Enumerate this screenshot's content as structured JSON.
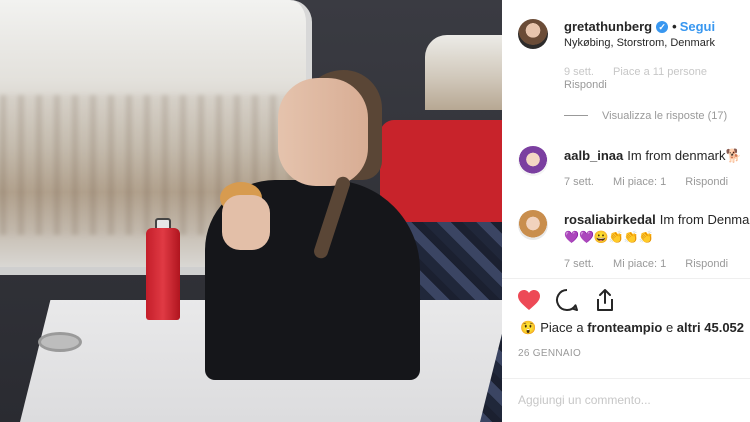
{
  "post": {
    "username": "gretathunberg",
    "follow_label": "Segui",
    "dot": "•",
    "location": "Nykøbing, Storstrom, Denmark",
    "verified_icon": "verified-badge-icon"
  },
  "caption_meta": {
    "time": "9 sett.",
    "likes": "Piace a 11 persone",
    "reply": "Rispondi"
  },
  "view_replies": "Visualizza le risposte (17)",
  "comments": [
    {
      "username": "aalb_inaa",
      "text": "Im from denmark🐕",
      "time": "7 sett.",
      "likes": "Mi piace: 1",
      "reply": "Rispondi"
    },
    {
      "username": "rosaliabirkedal",
      "text": "Im from Denmark",
      "emoji": "💜💜😀👏👏👏",
      "time": "7 sett.",
      "likes": "Mi piace: 1",
      "reply": "Rispondi"
    }
  ],
  "actions": {
    "like_icon": "heart-icon",
    "comment_icon": "comment-icon",
    "share_icon": "share-icon",
    "like_color": "#ed4956"
  },
  "likes": {
    "emoji": "😲",
    "prefix": "Piace a",
    "user": "fronteampio",
    "connector": "e",
    "others": "altri 45.052"
  },
  "date": "26 GENNAIO",
  "add_comment": {
    "placeholder": "Aggiungi un commento..."
  }
}
